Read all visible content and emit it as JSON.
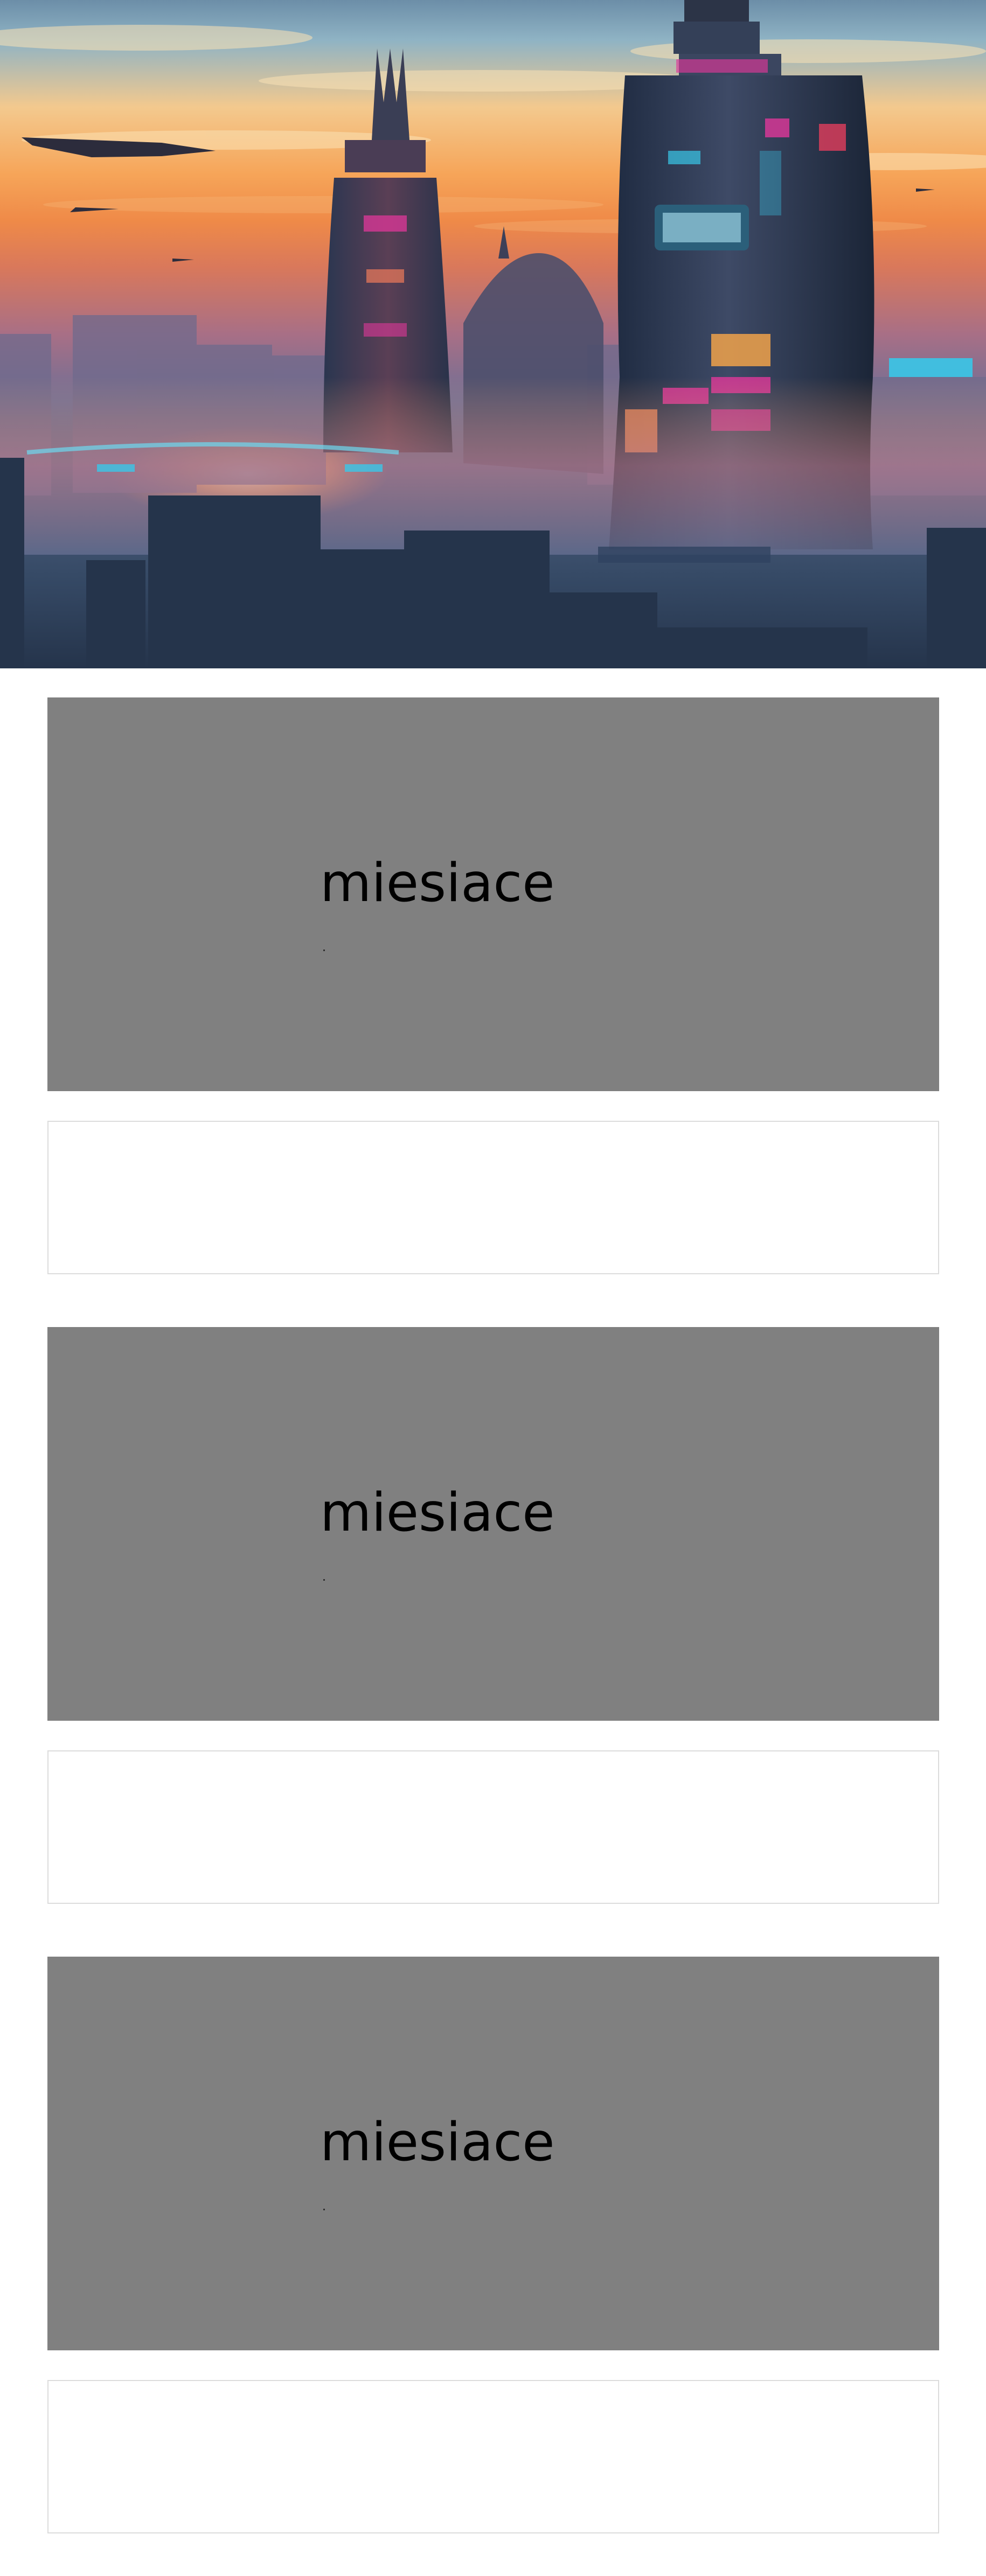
{
  "hero": {
    "image_icon": "futuristic-city-skyline-image",
    "alt": "",
    "colors": {
      "sky_top": "#6c8ea8",
      "sunset": "#f6a559",
      "haze": "#a86f86",
      "buildings": "#25344b",
      "neon_pink": "#e0379a",
      "neon_cyan": "#39c7e8"
    }
  },
  "cards": [
    {
      "media_caption": "miesiace",
      "media_color": "#808080",
      "body_text": ""
    },
    {
      "media_caption": "miesiace",
      "media_color": "#808080",
      "body_text": ""
    },
    {
      "media_caption": "miesiace",
      "media_color": "#808080",
      "body_text": ""
    }
  ]
}
